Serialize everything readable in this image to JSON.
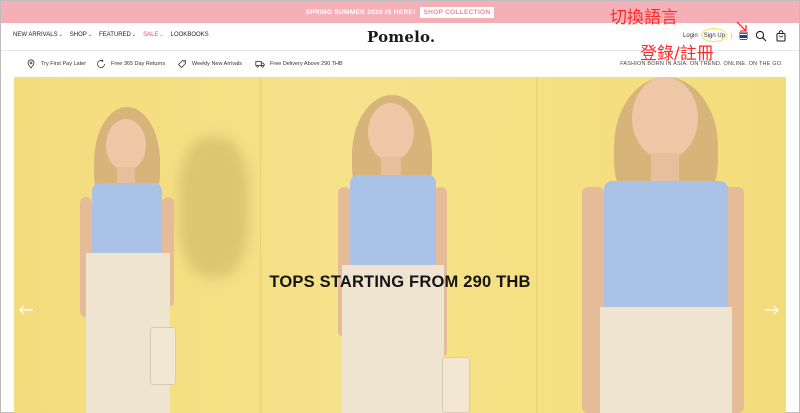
{
  "promo": {
    "text": "SPRING SUMMER 2020 IS HERE!",
    "button": "SHOP COLLECTION"
  },
  "header": {
    "nav": [
      {
        "label": "NEW ARRIVALS",
        "has_caret": true
      },
      {
        "label": "SHOP",
        "has_caret": true
      },
      {
        "label": "FEATURED",
        "has_caret": true
      },
      {
        "label": "SALE",
        "has_caret": true
      },
      {
        "label": "LOOKBOOKS",
        "has_caret": false
      }
    ],
    "logo": "Pomelo.",
    "login": "Login",
    "signup": "Sign Up",
    "separator": "|",
    "icons": [
      "thai-flag-icon",
      "search-icon",
      "bag-icon"
    ]
  },
  "usp": {
    "items": [
      {
        "icon": "location-pin-icon",
        "label": "Try First Pay Later"
      },
      {
        "icon": "return-arrow-icon",
        "label": "Free 365 Day Returns"
      },
      {
        "icon": "tag-icon",
        "label": "Weekly New Arrivals"
      },
      {
        "icon": "truck-icon",
        "label": "Free Delivery Above 290 THB"
      }
    ],
    "tagline": "FASHION BORN IN ASIA. ON TREND. ONLINE. ON THE GO."
  },
  "hero": {
    "headline": "TOPS STARTING FROM 290 THB"
  },
  "annotations": {
    "language": "切換語言",
    "login": "登錄/註冊"
  },
  "colors": {
    "promo_bg": "#f4b0b6",
    "sale": "#e94b5a",
    "hero_bg": "#f4dc7d",
    "annotation": "#ff2a2a"
  }
}
